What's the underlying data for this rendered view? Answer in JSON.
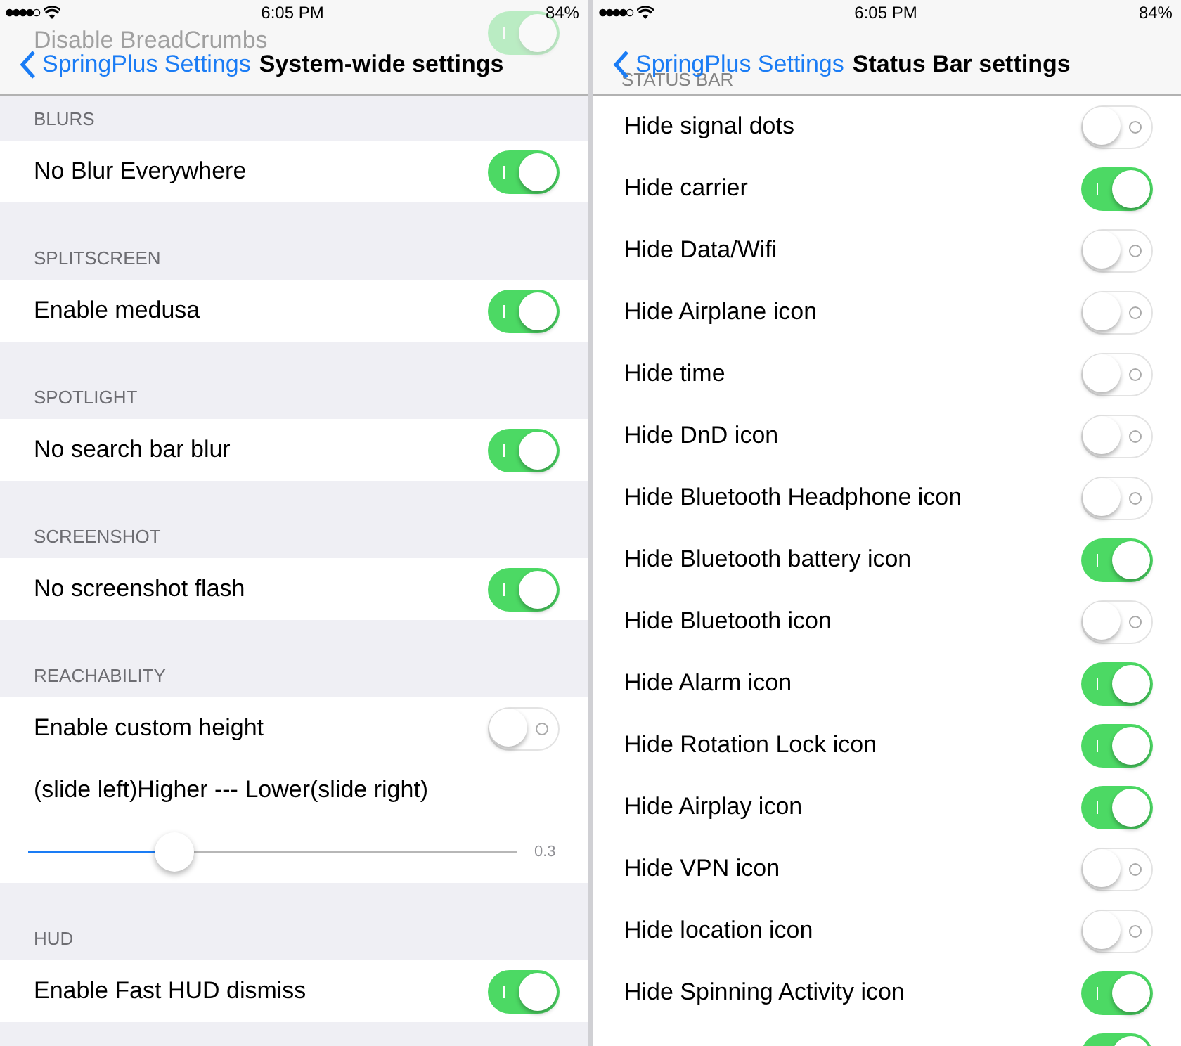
{
  "screens": [
    {
      "status_bar": {
        "time": "6:05 PM",
        "battery": "84%"
      },
      "ghost_row": {
        "label": "Disable BreadCrumbs",
        "on": true
      },
      "nav": {
        "back": "SpringPlus Settings",
        "title": "System-wide settings"
      },
      "sections": [
        {
          "header": "BLURS",
          "rows": [
            {
              "kind": "toggle",
              "label": "No Blur Everywhere",
              "on": true
            }
          ]
        },
        {
          "header": "SPLITSCREEN",
          "rows": [
            {
              "kind": "toggle",
              "label": "Enable medusa",
              "on": true
            }
          ]
        },
        {
          "header": "SPOTLIGHT",
          "rows": [
            {
              "kind": "toggle",
              "label": "No search bar blur",
              "on": true
            }
          ]
        },
        {
          "header": "SCREENSHOT",
          "rows": [
            {
              "kind": "toggle",
              "label": "No screenshot flash",
              "on": true
            }
          ]
        },
        {
          "header": "REACHABILITY",
          "rows": [
            {
              "kind": "toggle",
              "label": "Enable custom height",
              "on": false
            },
            {
              "kind": "text",
              "label": "(slide left)Higher --- Lower(slide right)"
            },
            {
              "kind": "slider",
              "level": 0.3,
              "reading": "0.3"
            }
          ]
        },
        {
          "header": "HUD",
          "rows": [
            {
              "kind": "toggle",
              "label": "Enable Fast HUD dismiss",
              "on": true
            }
          ]
        }
      ]
    },
    {
      "status_bar": {
        "time": "6:05 PM",
        "battery": "84%"
      },
      "ghost_header": "STATUS BAR",
      "nav": {
        "back": "SpringPlus Settings",
        "title": "Status Bar settings"
      },
      "sections": [
        {
          "rows": [
            {
              "kind": "toggle",
              "label": "Hide signal dots",
              "on": false
            },
            {
              "kind": "toggle",
              "label": "Hide carrier",
              "on": true
            },
            {
              "kind": "toggle",
              "label": "Hide Data/Wifi",
              "on": false
            },
            {
              "kind": "toggle",
              "label": "Hide Airplane icon",
              "on": false
            },
            {
              "kind": "toggle",
              "label": "Hide time",
              "on": false
            },
            {
              "kind": "toggle",
              "label": "Hide DnD icon",
              "on": false
            },
            {
              "kind": "toggle",
              "label": "Hide Bluetooth Headphone icon",
              "on": false
            },
            {
              "kind": "toggle",
              "label": "Hide Bluetooth battery icon",
              "on": true
            },
            {
              "kind": "toggle",
              "label": "Hide Bluetooth icon",
              "on": false
            },
            {
              "kind": "toggle",
              "label": "Hide Alarm icon",
              "on": true
            },
            {
              "kind": "toggle",
              "label": "Hide Rotation Lock icon",
              "on": true
            },
            {
              "kind": "toggle",
              "label": "Hide Airplay icon",
              "on": true
            },
            {
              "kind": "toggle",
              "label": "Hide VPN icon",
              "on": false
            },
            {
              "kind": "toggle",
              "label": "Hide location icon",
              "on": false
            },
            {
              "kind": "toggle",
              "label": "Hide Spinning Activity icon",
              "on": true
            },
            {
              "kind": "toggle",
              "on": true
            }
          ]
        }
      ]
    }
  ]
}
